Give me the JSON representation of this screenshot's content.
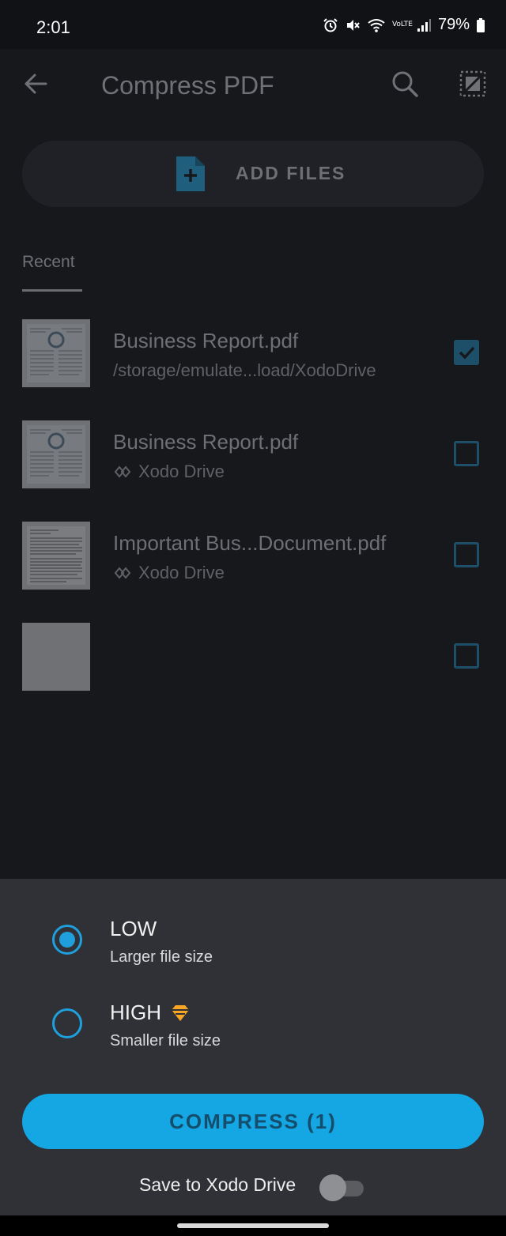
{
  "status_bar": {
    "time": "2:01",
    "battery": "79%",
    "network": "VoLTE"
  },
  "app_bar": {
    "title": "Compress PDF"
  },
  "add_files": {
    "label": "ADD FILES"
  },
  "tabs": {
    "recent": "Recent"
  },
  "files": [
    {
      "name": "Business Report.pdf",
      "location": "/storage/emulate...load/XodoDrive",
      "checked": true
    },
    {
      "name": "Business Report.pdf",
      "location": "Xodo Drive",
      "checked": false
    },
    {
      "name": "Important Bus...Document.pdf",
      "location": "Xodo Drive",
      "checked": false
    },
    {
      "name": "",
      "location": "",
      "checked": false
    }
  ],
  "compression": {
    "low_title": "LOW",
    "low_subtitle": "Larger file size",
    "high_title": "HIGH",
    "high_subtitle": "Smaller file size",
    "selected": "low"
  },
  "compress_button": "COMPRESS (1)",
  "save_to_drive": {
    "label": "Save to Xodo Drive",
    "enabled": false
  },
  "colors": {
    "accent": "#15a6e4",
    "background": "#17181c",
    "sheet": "#2f3136",
    "premium": "#f5a623"
  }
}
